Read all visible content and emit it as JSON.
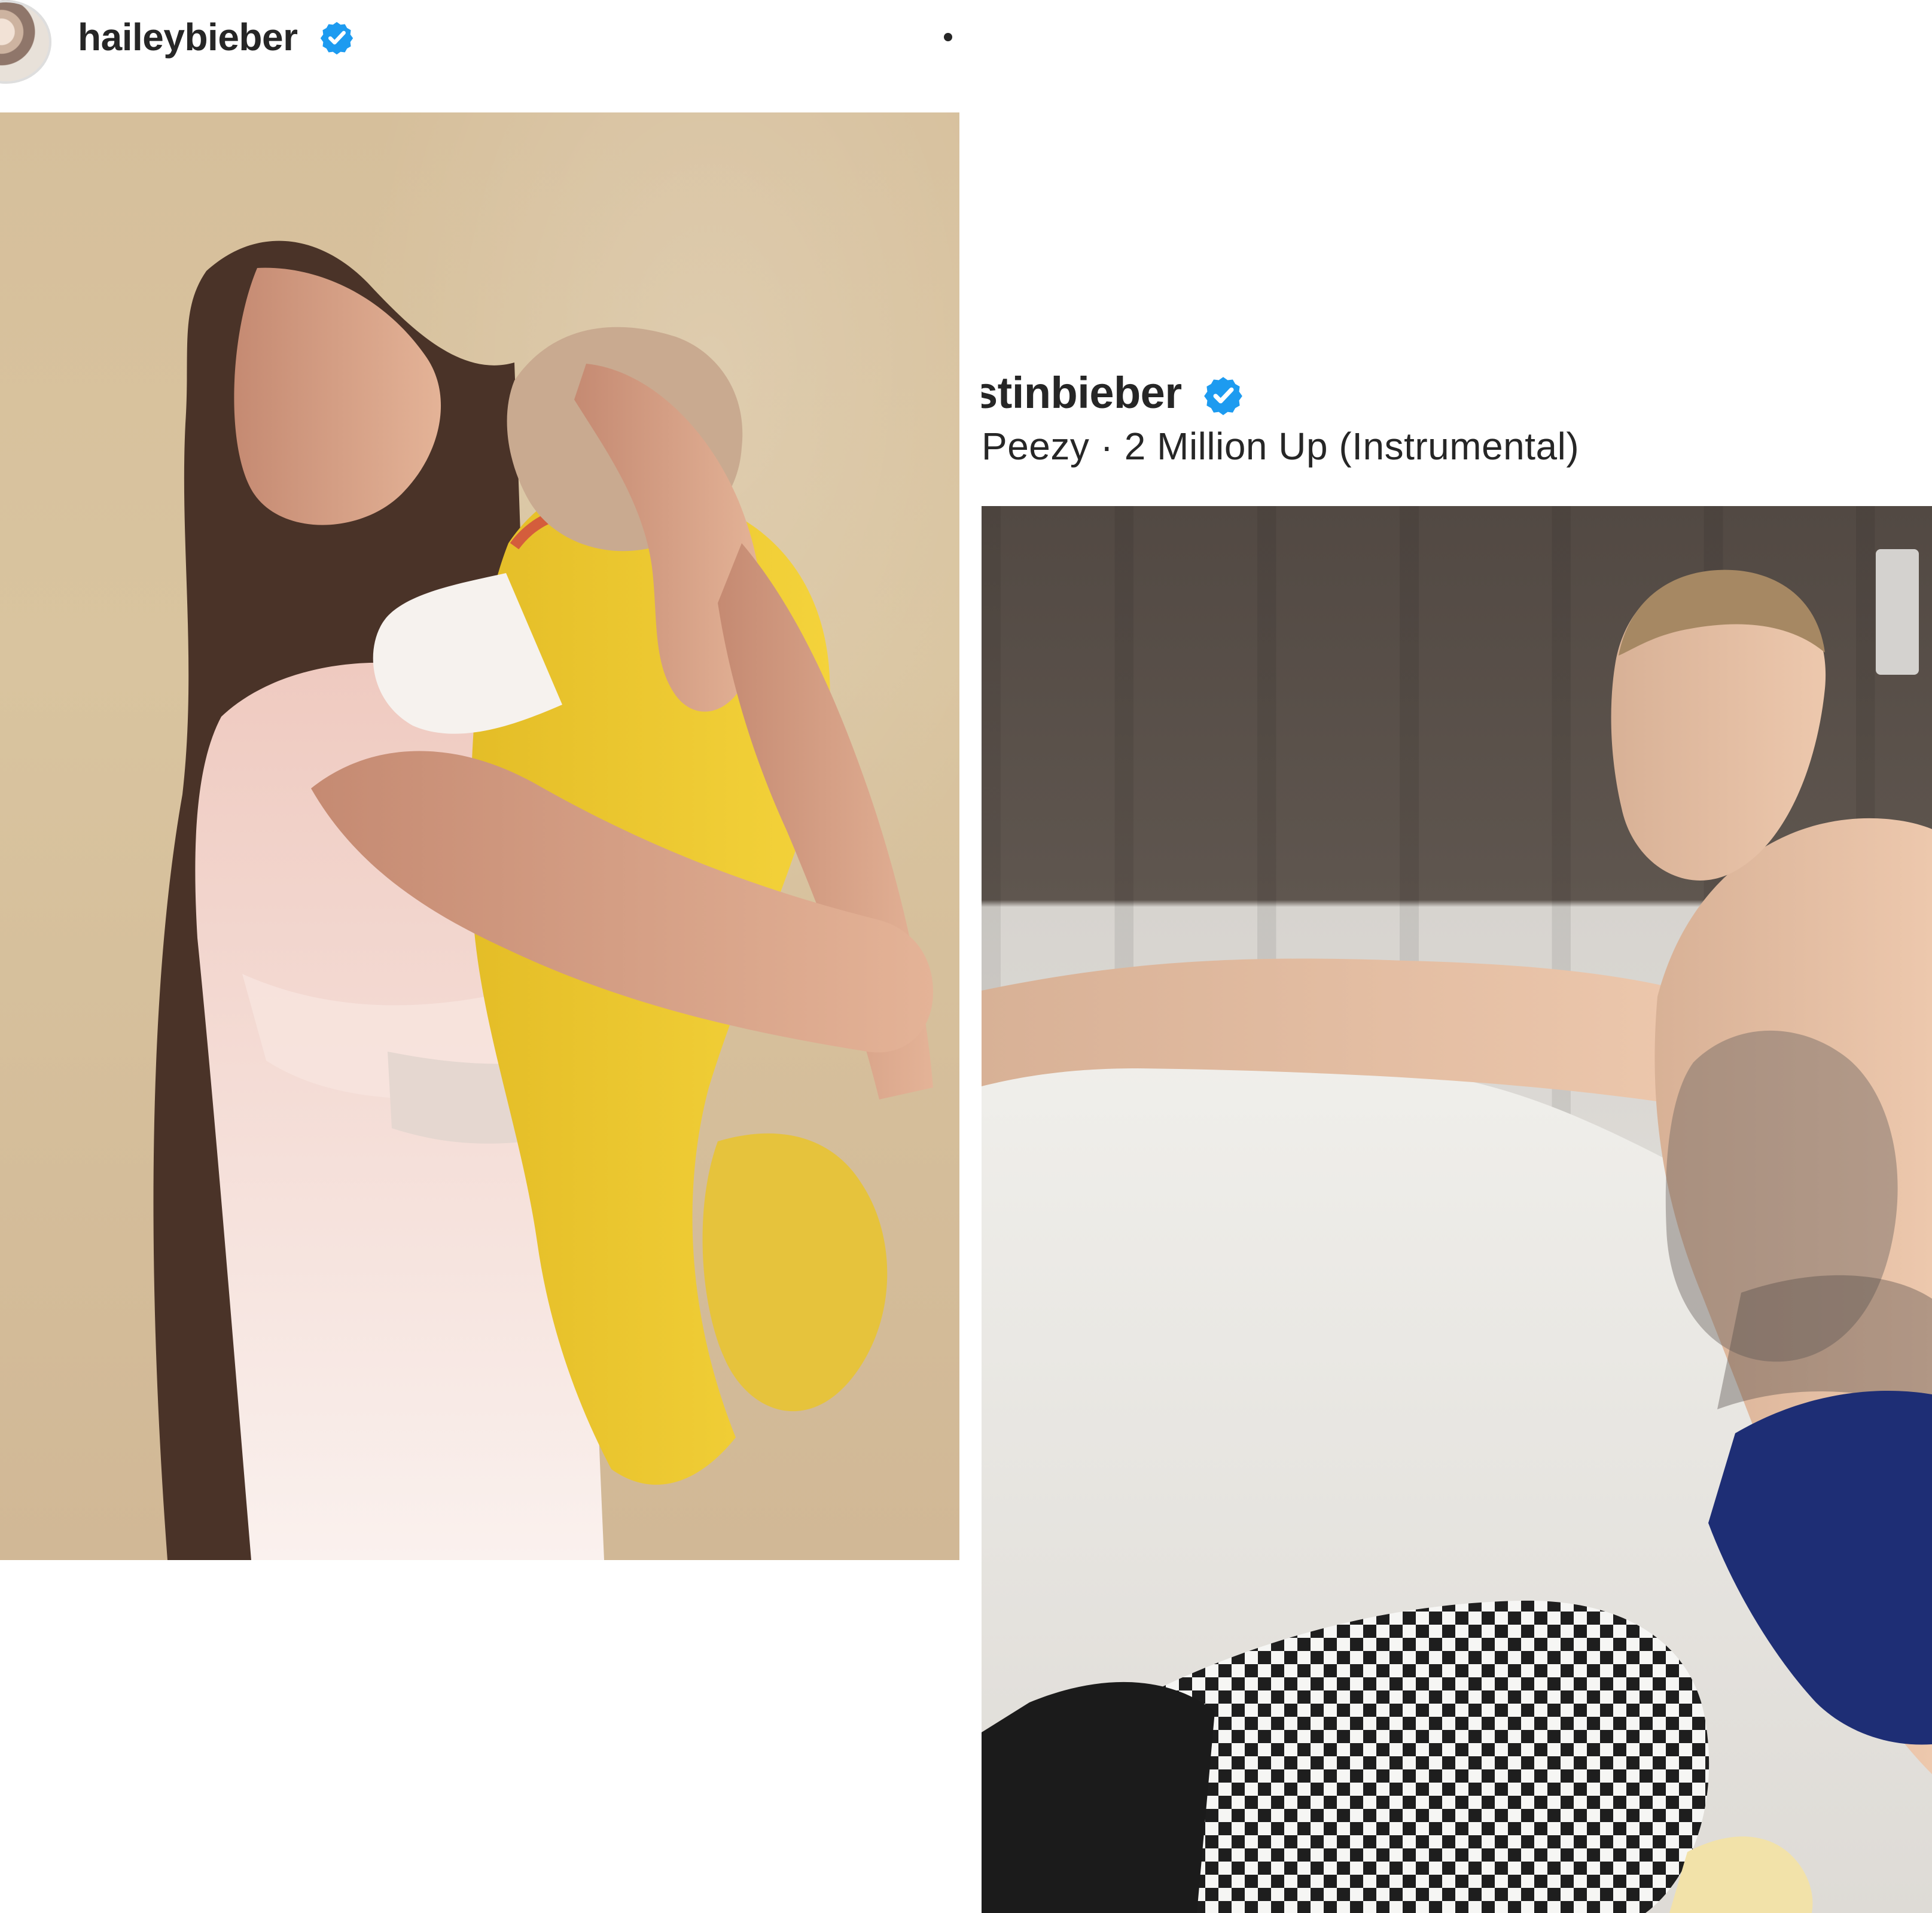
{
  "left_post": {
    "username": "haileybieber",
    "avatar_icon": "profile-avatar",
    "verified_icon": "verified-badge-icon",
    "more_icon": "more-options-icon",
    "image_subject": "woman holding a baby in yellow clothing"
  },
  "right_post": {
    "username_fragment": "stinbieber",
    "verified_icon": "verified-badge-icon",
    "audio_line": "Peezy · 2 Million Up (Instrumental)",
    "image_subject": "shirtless tattooed man sitting on a light sofa"
  },
  "colors": {
    "text": "#262626",
    "verified_blue": "#1d9bf0",
    "background": "#ffffff"
  }
}
